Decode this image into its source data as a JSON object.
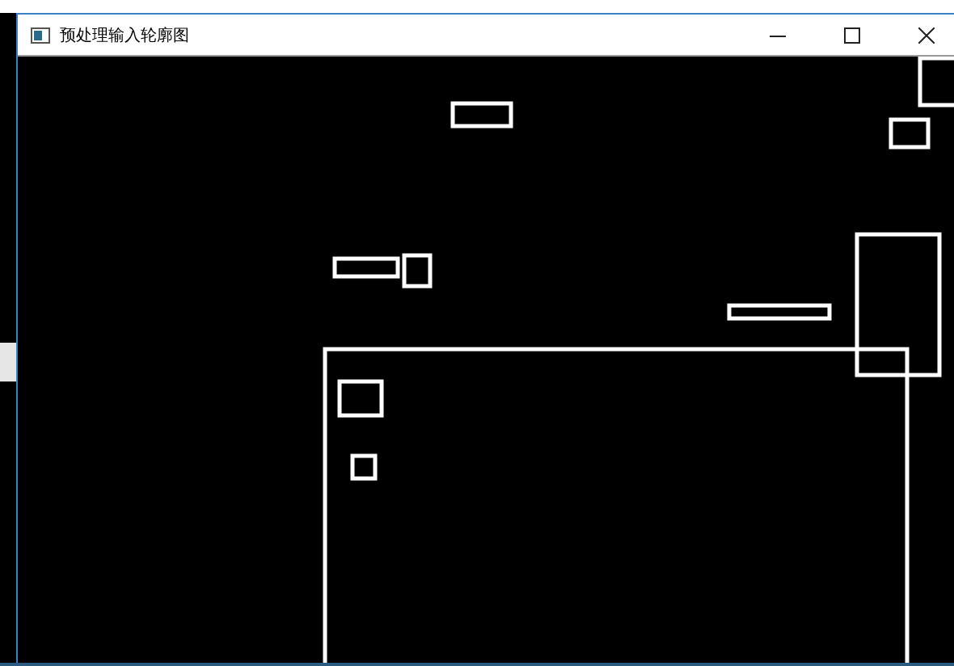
{
  "window": {
    "title": "预处理输入轮廓图"
  }
}
